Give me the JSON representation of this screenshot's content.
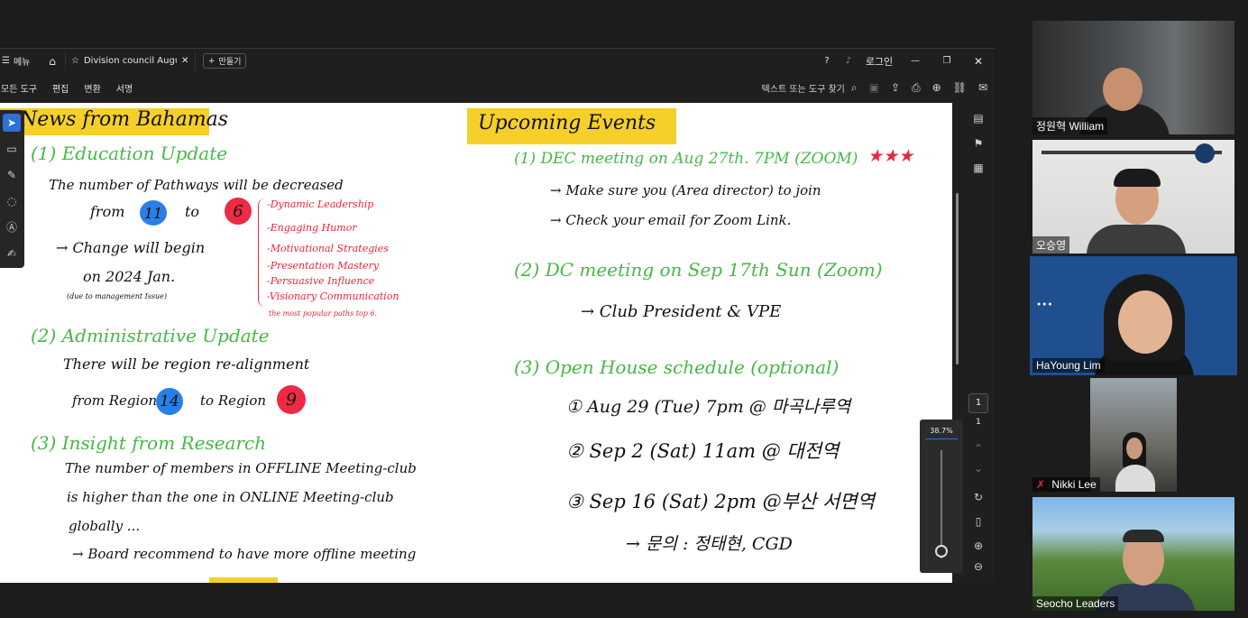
{
  "titlebar": {
    "menu_label": "메뉴",
    "tab_title": "Division council Augu...",
    "new_tab_label": "만들기",
    "login_label": "로그인"
  },
  "toolbar": {
    "menus": [
      "모든 도구",
      "편집",
      "변환",
      "서명"
    ],
    "search_label": "텍스트 또는 도구 찾기"
  },
  "canvas": {
    "left": {
      "title": "News from Bahamas",
      "s1_heading": "(1) Education Update",
      "s1_line1": "The number of Pathways will be decreased",
      "s1_from": "from",
      "s1_to": "to",
      "s1_n_from": "11",
      "s1_n_to": "6",
      "s1_change": "→ Change will begin",
      "s1_on": "on 2024 Jan.",
      "s1_note": "(due to management Issue)",
      "paths": [
        "-Dynamic Leadership",
        "-Engaging Humor",
        "-Motivational Strategies",
        "-Presentation Mastery",
        "-Persuasive Influence",
        "-Visionary Communication"
      ],
      "paths_note": "the most popular paths top 6.",
      "s2_heading": "(2) Administrative Update",
      "s2_line1": "There will be region re-alignment",
      "s2_from": "from Region",
      "s2_n_from": "14",
      "s2_to": "to Region",
      "s2_n_to": "9",
      "s3_heading": "(3) Insight from Research",
      "s3_line1": "The number of members in OFFLINE Meeting-club",
      "s3_line2": "is higher than the one in ONLINE Meeting-club",
      "s3_line3": "globally ...",
      "s3_line4": "→ Board recommend to have more offline meeting"
    },
    "right": {
      "title": "Upcoming Events",
      "e1": "(1) DEC meeting on Aug 27th. 7PM (ZOOM)",
      "e1_stars": "★★★",
      "e1_a": "→ Make sure you (Area director) to join",
      "e1_b": "→ Check your email for Zoom Link.",
      "e2": "(2) DC meeting on Sep 17th Sun (Zoom)",
      "e2_a": "→ Club President & VPE",
      "e3": "(3) Open House schedule (optional)",
      "e3_1": "① Aug 29 (Tue) 7pm @ 마곡나루역",
      "e3_2": "② Sep 2 (Sat) 11am @ 대전역",
      "e3_3": "③ Sep 16 (Sat) 2pm @부산 서면역",
      "e3_contact": "→ 문의 : 정태현, CGD"
    }
  },
  "viewer": {
    "page_current": "1",
    "page_total": "1",
    "zoom": "38.7%"
  },
  "participants": [
    {
      "name": "정원혁 William",
      "muted": false
    },
    {
      "name": "오승영",
      "muted": false
    },
    {
      "name": "HaYoung Lim",
      "muted": false,
      "active": true
    },
    {
      "name": "Nikki Lee",
      "muted": true
    },
    {
      "name": "Seocho Leaders",
      "muted": false
    }
  ],
  "colors": {
    "accent_blue": "#2f6fd8",
    "highlight_yellow": "#f5cf2a",
    "ink_green": "#46b846",
    "ink_red": "#e8263c",
    "active_speaker": "#d8e23a"
  }
}
